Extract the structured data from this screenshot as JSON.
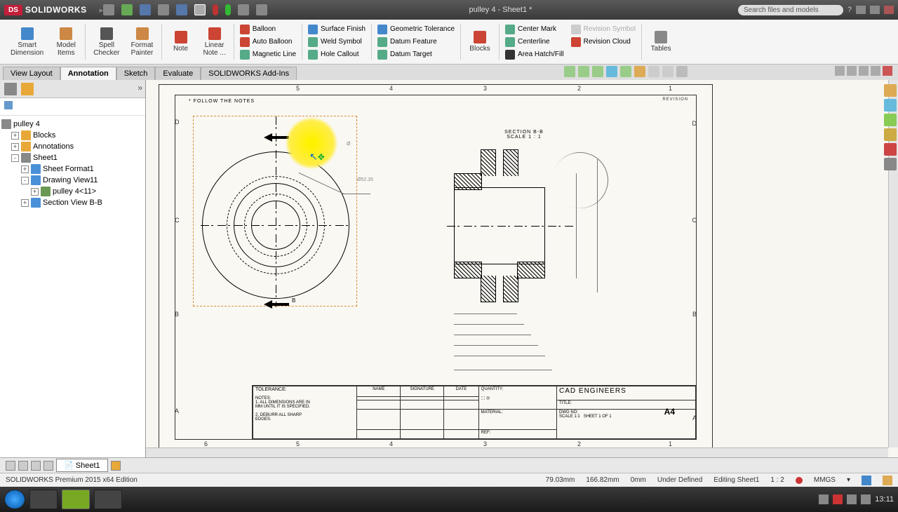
{
  "app": {
    "brand_short": "DS",
    "brand": "SOLIDWORKS",
    "title": "pulley 4 - Sheet1 *",
    "search_placeholder": "Search files and models"
  },
  "ribbon": {
    "big": [
      {
        "label": "Smart\nDimension"
      },
      {
        "label": "Model\nItems"
      },
      {
        "label": "Spell\nChecker"
      },
      {
        "label": "Format\nPainter"
      },
      {
        "label": "Note"
      },
      {
        "label": "Linear\nNote ..."
      }
    ],
    "col1": [
      {
        "label": "Balloon"
      },
      {
        "label": "Auto Balloon"
      },
      {
        "label": "Magnetic Line"
      }
    ],
    "col2": [
      {
        "label": "Surface Finish"
      },
      {
        "label": "Weld Symbol"
      },
      {
        "label": "Hole Callout"
      }
    ],
    "col3": [
      {
        "label": "Geometric Tolerance"
      },
      {
        "label": "Datum Feature"
      },
      {
        "label": "Datum Target"
      }
    ],
    "big2": [
      {
        "label": "Blocks"
      }
    ],
    "col4": [
      {
        "label": "Center Mark"
      },
      {
        "label": "Centerline"
      },
      {
        "label": "Area Hatch/Fill"
      }
    ],
    "col5": [
      {
        "label": "Revision Symbol"
      },
      {
        "label": "Revision Cloud"
      },
      {
        "label": ""
      }
    ],
    "big3": [
      {
        "label": "Tables"
      }
    ]
  },
  "tabs": [
    {
      "label": "View Layout",
      "active": false
    },
    {
      "label": "Annotation",
      "active": true
    },
    {
      "label": "Sketch",
      "active": false
    },
    {
      "label": "Evaluate",
      "active": false
    },
    {
      "label": "SOLIDWORKS Add-Ins",
      "active": false
    }
  ],
  "tree": {
    "root": "pulley 4",
    "items": [
      {
        "label": "Blocks",
        "indent": 1,
        "exp": "+"
      },
      {
        "label": "Annotations",
        "indent": 1,
        "exp": "+"
      },
      {
        "label": "Sheet1",
        "indent": 1,
        "exp": "-"
      },
      {
        "label": "Sheet Format1",
        "indent": 2,
        "exp": "+"
      },
      {
        "label": "Drawing View11",
        "indent": 2,
        "exp": "-"
      },
      {
        "label": "pulley 4<11>",
        "indent": 3,
        "exp": "+"
      },
      {
        "label": "Section View B-B",
        "indent": 2,
        "exp": "+"
      }
    ]
  },
  "drawing": {
    "note": "* FOLLOW THE NOTES",
    "section_header1": "SECTION B-B",
    "section_header2": "SCALE 1 : 1",
    "revision": "REVISION",
    "zones_h": [
      "6",
      "5",
      "4",
      "3",
      "2",
      "1"
    ],
    "zones_v": [
      "D",
      "C",
      "B",
      "A"
    ],
    "cursor_diam": "Ø52.35"
  },
  "titleblock": {
    "tolerance": "TOLERANCE:",
    "notes1": "NOTES:",
    "notes2": "1. ALL DIMENSIONS ARE IN",
    "notes3": "MM UNTIL IT IS SPECIFIED.",
    "notes4": "2. DEBURR ALL SHARP",
    "notes5": "EDGES.",
    "hdr_name": "NAME",
    "hdr_sig": "SIGNATURE",
    "hdr_date": "DATE",
    "qty": "QUANTITY:",
    "company": "CAD ENGINEERS",
    "title_l": "TITLE:",
    "material": "MATERIAL:",
    "ref": "REF:",
    "dwgno": "DWG NO:",
    "scale": "SCALE 1:1",
    "sheet": "SHEET 1 OF 1",
    "size": "A4"
  },
  "bottom_tab": "Sheet1",
  "status": {
    "edition": "SOLIDWORKS Premium 2015 x64 Edition",
    "x": "79.03mm",
    "y": "166.82mm",
    "z": "0mm",
    "defined": "Under Defined",
    "editing": "Editing Sheet1",
    "scale": "1 : 2",
    "units": "MMGS"
  },
  "clock": "13:11"
}
